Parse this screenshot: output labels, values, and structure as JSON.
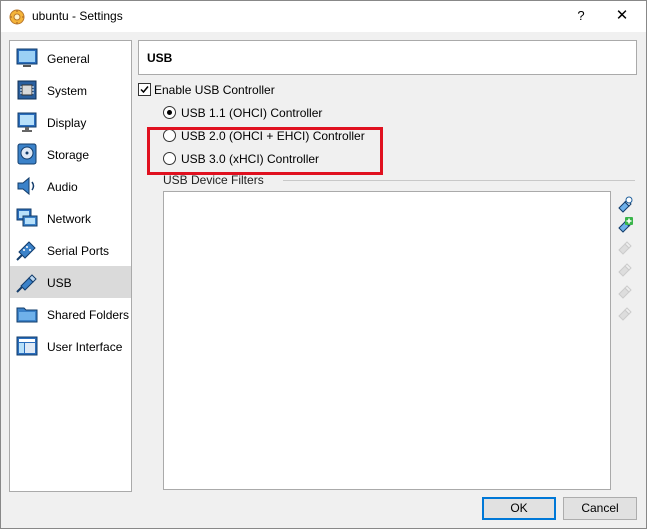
{
  "window": {
    "title": "ubuntu - Settings",
    "help_label": "?",
    "close_label": "✕"
  },
  "sidebar": {
    "active": "USB",
    "items": [
      {
        "label": "General",
        "icon": "general-icon"
      },
      {
        "label": "System",
        "icon": "system-icon"
      },
      {
        "label": "Display",
        "icon": "display-icon"
      },
      {
        "label": "Storage",
        "icon": "storage-icon"
      },
      {
        "label": "Audio",
        "icon": "audio-icon"
      },
      {
        "label": "Network",
        "icon": "network-icon"
      },
      {
        "label": "Serial Ports",
        "icon": "serial-ports-icon"
      },
      {
        "label": "USB",
        "icon": "usb-icon"
      },
      {
        "label": "Shared Folders",
        "icon": "shared-folders-icon"
      },
      {
        "label": "User Interface",
        "icon": "user-interface-icon"
      }
    ]
  },
  "page": {
    "title": "USB",
    "enable_usb_label": "Enable USB Controller",
    "enable_usb_checked": true,
    "controllers": [
      {
        "label": "USB 1.1 (OHCI) Controller",
        "selected": true
      },
      {
        "label": "USB 2.0 (OHCI + EHCI) Controller",
        "selected": false
      },
      {
        "label": "USB 3.0 (xHCI) Controller",
        "selected": false
      }
    ],
    "filters_label": "USB Device Filters",
    "filter_tools": [
      "add-empty-filter-icon",
      "add-filter-from-device-icon",
      "edit-filter-icon",
      "remove-filter-icon",
      "move-filter-up-icon",
      "move-filter-down-icon"
    ]
  },
  "buttons": {
    "ok": "OK",
    "cancel": "Cancel"
  },
  "colors": {
    "highlight": "#e0101f",
    "active_item": "#dadada",
    "ok_border": "#0078d7"
  }
}
